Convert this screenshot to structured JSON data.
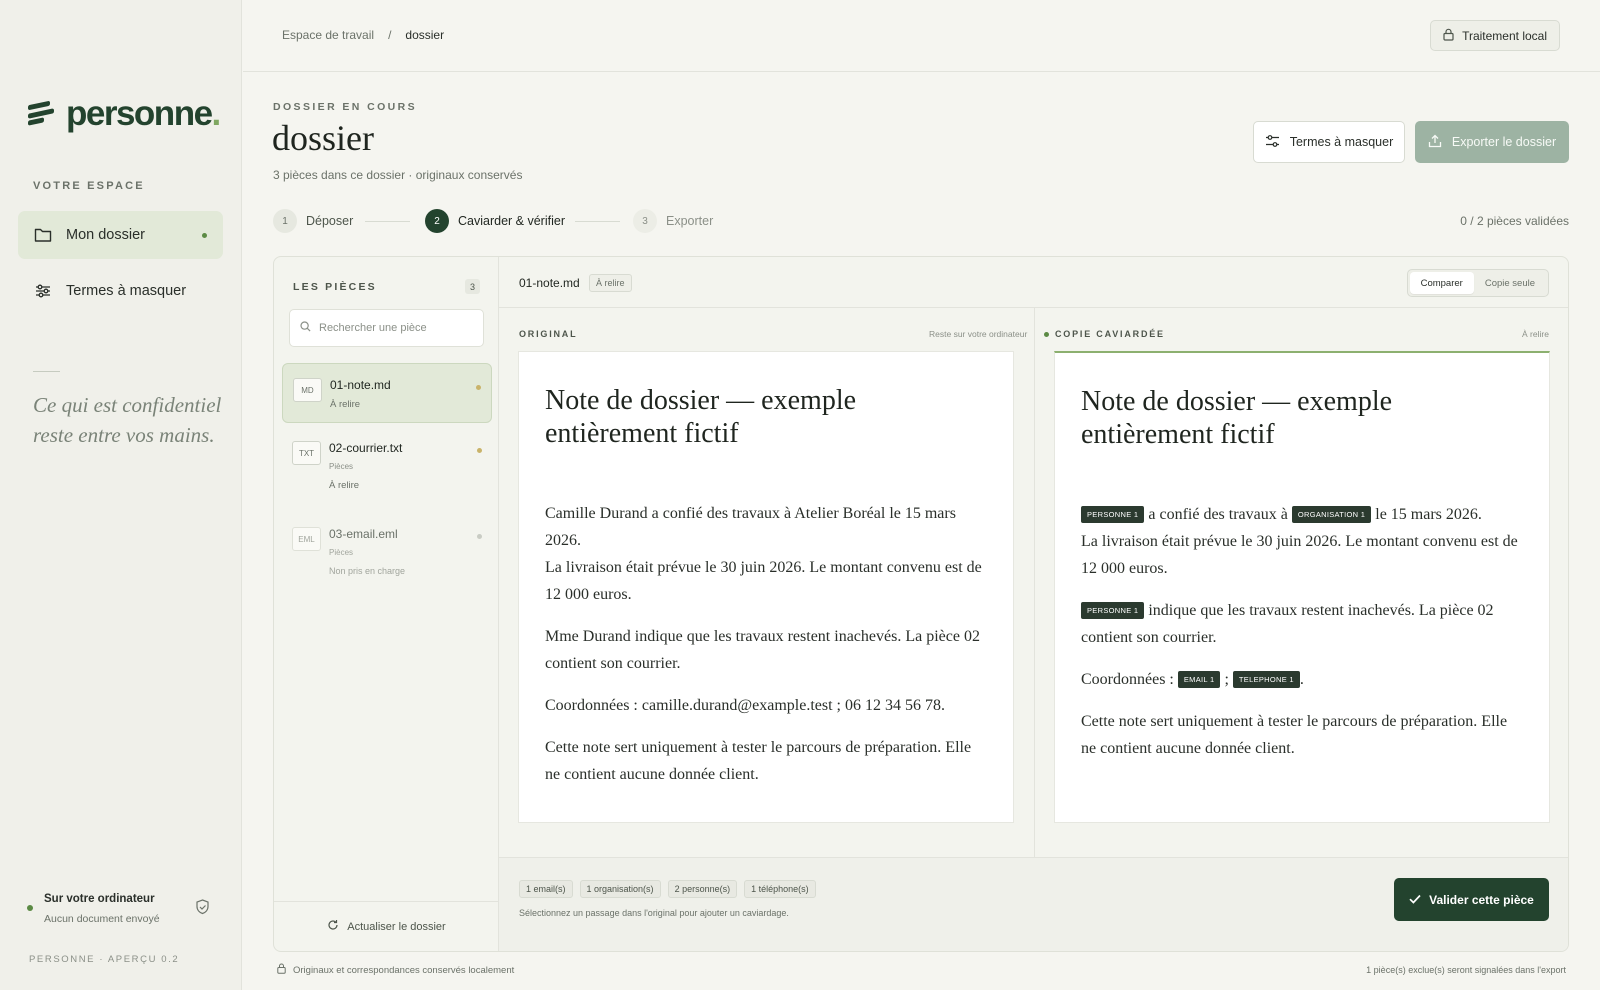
{
  "brand": {
    "name": "personne",
    "dot": "."
  },
  "sidebar": {
    "section_label": "VOTRE ESPACE",
    "items": [
      {
        "label": "Mon dossier",
        "active": true
      },
      {
        "label": "Termes à masquer",
        "active": false
      }
    ],
    "quote_line1": "Ce qui est confidentiel",
    "quote_line2": "reste entre vos mains.",
    "status_title": "Sur votre ordinateur",
    "status_sub": "Aucun document envoyé",
    "version": "PERSONNE · APERÇU 0.2"
  },
  "topbar": {
    "breadcrumb": [
      "Espace de travail",
      "/",
      "dossier"
    ],
    "local_label": "Traitement local"
  },
  "header": {
    "kicker": "DOSSIER EN COURS",
    "title": "dossier",
    "subtitle": "3 pièces dans ce dossier · originaux conservés",
    "terms_button": "Termes à masquer",
    "export_button": "Exporter le dossier"
  },
  "stepper": {
    "steps": [
      {
        "num": "1",
        "label": "Déposer",
        "state": "done"
      },
      {
        "num": "2",
        "label": "Caviarder & vérifier",
        "state": "active"
      },
      {
        "num": "3",
        "label": "Exporter",
        "state": "todo"
      }
    ],
    "validated": "0 / 2 pièces validées"
  },
  "pieces": {
    "heading": "LES PIÈCES",
    "count": "3",
    "search_placeholder": "Rechercher une pièce",
    "items": [
      {
        "ext": "MD",
        "name": "01-note.md",
        "sub": "",
        "status": "À relire",
        "dot": "#c9b36a"
      },
      {
        "ext": "TXT",
        "name": "02-courrier.txt",
        "sub": "Pièces",
        "status": "À relire",
        "dot": "#c9b36a"
      },
      {
        "ext": "EML",
        "name": "03-email.eml",
        "sub": "Pièces",
        "status": "Non pris en charge",
        "dot": "#c9ccc4"
      }
    ],
    "refresh": "Actualiser le dossier"
  },
  "document": {
    "name": "01-note.md",
    "badge": "À relire",
    "view_compare": "Comparer",
    "view_copy": "Copie seule",
    "original_label": "ORIGINAL",
    "original_note": "Reste sur votre ordinateur",
    "redacted_label": "COPIE CAVIARDÉE",
    "redacted_note": "À relire",
    "heading": "Note de dossier — exemple entièrement fictif",
    "original_paragraphs": [
      "Camille Durand a confié des travaux à Atelier Boréal le 15 mars 2026.",
      "La livraison était prévue le 30 juin 2026. Le montant convenu est de 12 000 euros.",
      "Mme Durand indique que les travaux restent inachevés. La pièce 02 contient son courrier.",
      "Coordonnées : camille.durand@example.test ; 06 12 34 56 78.",
      "Cette note sert uniquement à tester le parcours de préparation. Elle ne contient aucune donnée client."
    ],
    "redacted": {
      "p1_tag1": "PERSONNE 1",
      "p1_mid": " a confié des travaux à ",
      "p1_tag2": "ORGANISATION 1",
      "p1_end": " le 15 mars 2026.",
      "p1_line2": "La livraison était prévue le 30 juin 2026. Le montant convenu est de 12 000 euros.",
      "p2_tag": "PERSONNE 1",
      "p2_text": " indique que les travaux restent inachevés. La pièce 02 contient son courrier.",
      "p3_text": "Coordonnées : ",
      "p3_tag1": "EMAIL 1",
      "p3_sep": " ; ",
      "p3_tag2": "TELEPHONE 1",
      "p3_end": ".",
      "p4_text": "Cette note sert uniquement à tester le parcours de préparation. Elle ne contient aucune donnée client."
    },
    "chips": [
      "1 email(s)",
      "1 organisation(s)",
      "2 personne(s)",
      "1 téléphone(s)"
    ],
    "hint": "Sélectionnez un passage dans l'original pour ajouter un caviardage.",
    "validate_button": "Valider cette pièce"
  },
  "footer": {
    "left": "Originaux et correspondances conservés localement",
    "right": "1 pièce(s) exclue(s) seront signalées dans l'export"
  },
  "colors": {
    "accent": "#23432e",
    "accent_light": "#e2e9d8",
    "status_green": "#5b8a44"
  }
}
